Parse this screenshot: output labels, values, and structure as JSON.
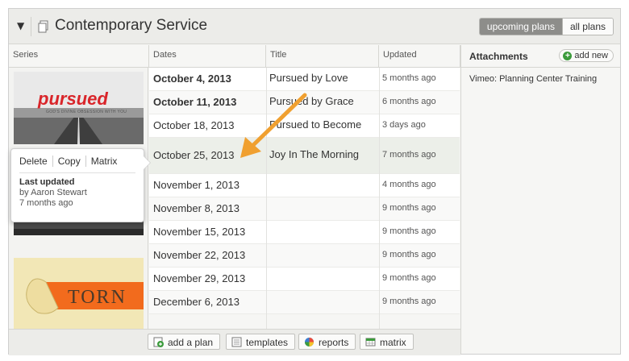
{
  "header": {
    "title": "Contemporary Service",
    "toggle": {
      "upcoming": "upcoming plans",
      "all": "all plans"
    }
  },
  "columns": {
    "series": "Series",
    "dates": "Dates",
    "title": "Title",
    "updated": "Updated"
  },
  "series_images": [
    {
      "name": "pursued-series-image",
      "text": "pursued",
      "subtitle": "GOD'S DIVINE OBSESSION WITH YOU"
    },
    {
      "name": "torn-series-image",
      "text": "TORN"
    }
  ],
  "plans": [
    {
      "date": "October 4, 2013",
      "title": "Pursued by Love",
      "updated": "5 months ago",
      "bold": true
    },
    {
      "date": "October 11, 2013",
      "title": "Pursued by Grace",
      "updated": "6 months ago",
      "bold": true
    },
    {
      "date": "October 18, 2013",
      "title": "Pursued to Become",
      "updated": "3 days ago",
      "bold": false
    },
    {
      "date": "October 25, 2013",
      "title": "Joy In The Morning",
      "updated": "7 months ago",
      "bold": false
    },
    {
      "date": "November 1, 2013",
      "title": "",
      "updated": "4 months ago",
      "bold": false
    },
    {
      "date": "November 8, 2013",
      "title": "",
      "updated": "9 months ago",
      "bold": false
    },
    {
      "date": "November 15, 2013",
      "title": "",
      "updated": "9 months ago",
      "bold": false
    },
    {
      "date": "November 22, 2013",
      "title": "",
      "updated": "9 months ago",
      "bold": false
    },
    {
      "date": "November 29, 2013",
      "title": "",
      "updated": "9 months ago",
      "bold": false
    },
    {
      "date": "December 6, 2013",
      "title": "",
      "updated": "9 months ago",
      "bold": false
    }
  ],
  "popup": {
    "actions": [
      "Delete",
      "Copy",
      "Matrix"
    ],
    "last_updated_label": "Last updated",
    "by": "by Aaron Stewart",
    "when": "7 months ago"
  },
  "attachments": {
    "title": "Attachments",
    "add_new": "add new",
    "items": [
      "Vimeo: Planning Center Training"
    ]
  },
  "footer": {
    "add_plan": "add a plan",
    "templates": "templates",
    "reports": "reports",
    "matrix": "matrix"
  },
  "colors": {
    "accent_arrow": "#f0a030",
    "highlight_row": "#ecefe9",
    "toggle_active": "#8d8d8a"
  }
}
